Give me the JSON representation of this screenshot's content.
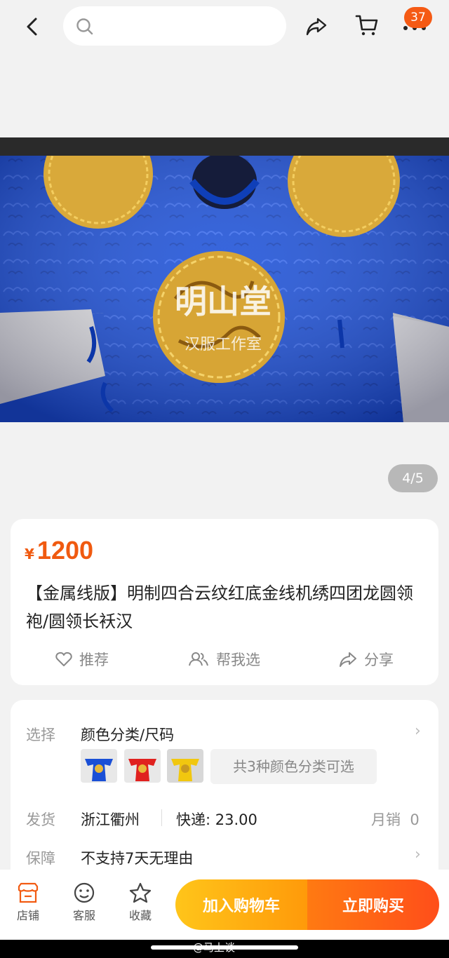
{
  "topbar": {
    "search_placeholder": "",
    "badge_count": "37"
  },
  "gallery": {
    "counter": "4/5",
    "watermark_title": "明山堂",
    "watermark_sub": "汉服工作室"
  },
  "product": {
    "currency": "¥",
    "price": "1200",
    "title": "【金属线版】明制四合云纹红底金线机绣四团龙圆领袍/圆领长袄汉",
    "actions": [
      {
        "label": "推荐"
      },
      {
        "label": "帮我选"
      },
      {
        "label": "分享"
      }
    ]
  },
  "details": {
    "select_label": "选择",
    "select_value": "颜色分类/尺码",
    "colors_summary": "共3种颜色分类可选",
    "ship_label": "发货",
    "ship_from": "浙江衢州",
    "ship_fee": "快递: 23.00",
    "monthly_sales": "月销  0",
    "guarantee_label": "保障",
    "guarantee_value": "不支持7天无理由"
  },
  "bottombar": {
    "store": "店铺",
    "service": "客服",
    "favorite": "收藏",
    "add_to_cart": "加入购物车",
    "buy_now": "立即购买"
  },
  "footer": {
    "watermark": "@马上谈"
  },
  "colors": {
    "accent": "#f05a10",
    "robe_blue": "#1a4fd6",
    "gold": "#e8b83a"
  }
}
